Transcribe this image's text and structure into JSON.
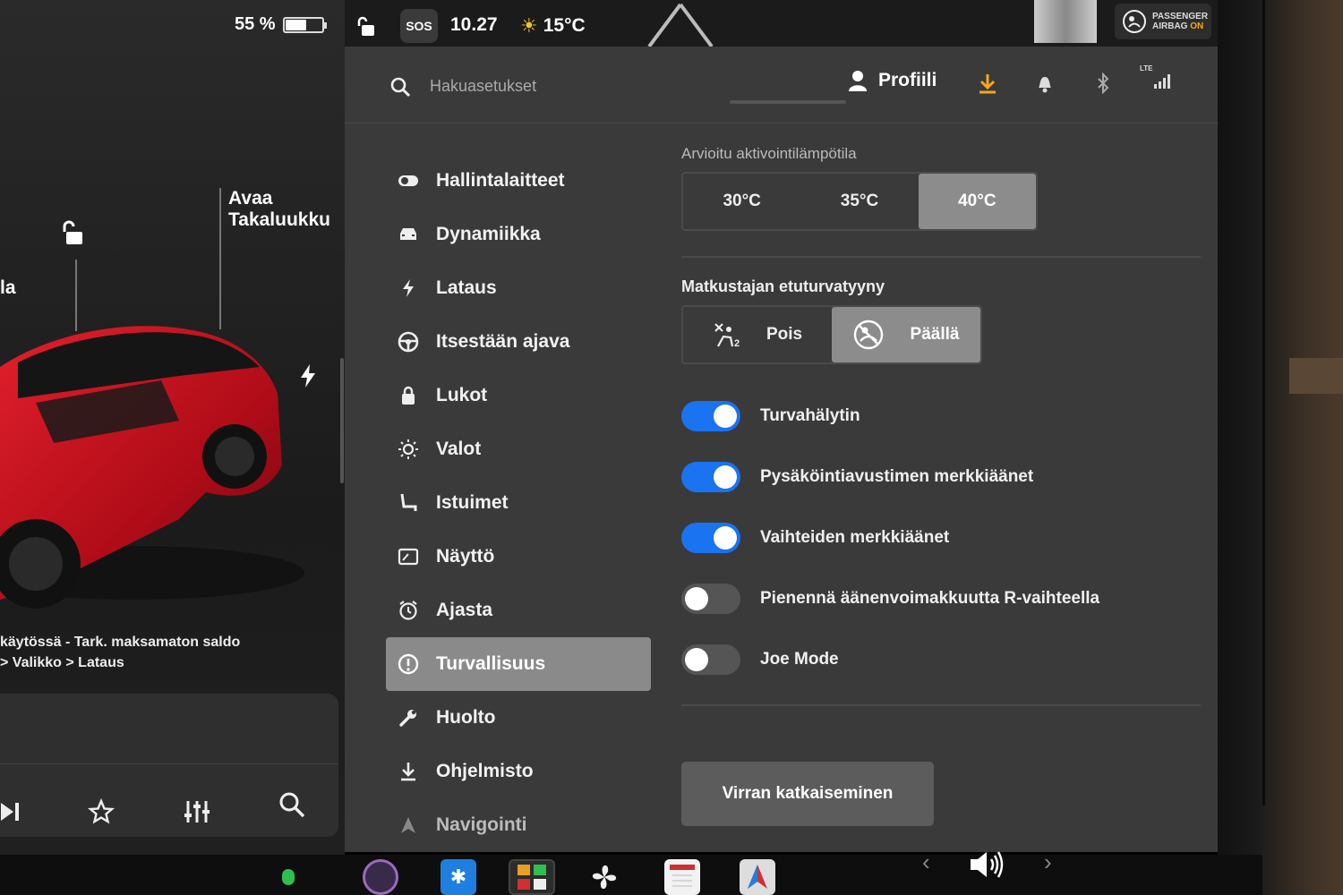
{
  "status": {
    "battery_percent": "55 %",
    "battery_level": 0.55,
    "sos_label": "SOS",
    "time": "10.27",
    "temperature": "15°C",
    "airbag_line1": "PASSENGER",
    "airbag_line2": "AIRBAG",
    "airbag_state": "ON"
  },
  "car": {
    "label_left": "la",
    "trunk_label_line1": "Avaa",
    "trunk_label_line2": "Takaluukku",
    "status_line1": "käytössä - Tark. maksamaton saldo",
    "status_line2": "> Valikko > Lataus"
  },
  "header": {
    "search_placeholder": "Hakuasetukset",
    "profile_label": "Profiili",
    "lte_label": "LTE"
  },
  "menu": [
    {
      "label": "Hallintalaitteet",
      "icon": "toggle-icon"
    },
    {
      "label": "Dynamiikka",
      "icon": "car-icon"
    },
    {
      "label": "Lataus",
      "icon": "bolt-icon"
    },
    {
      "label": "Itsestään ajava",
      "icon": "steering-wheel-icon"
    },
    {
      "label": "Lukot",
      "icon": "lock-icon"
    },
    {
      "label": "Valot",
      "icon": "light-icon"
    },
    {
      "label": "Istuimet",
      "icon": "seat-icon"
    },
    {
      "label": "Näyttö",
      "icon": "display-icon"
    },
    {
      "label": "Ajasta",
      "icon": "alarm-clock-icon"
    },
    {
      "label": "Turvallisuus",
      "icon": "alert-circle-icon",
      "active": true
    },
    {
      "label": "Huolto",
      "icon": "wrench-icon"
    },
    {
      "label": "Ohjelmisto",
      "icon": "download-icon"
    },
    {
      "label": "Navigointi",
      "icon": "navigation-icon"
    }
  ],
  "content": {
    "activation_temp_label": "Arvioitu aktivointilämpötila",
    "activation_temp_options": [
      "30°C",
      "35°C",
      "40°C"
    ],
    "activation_temp_selected": "40°C",
    "airbag_label": "Matkustajan etuturvatyyny",
    "airbag_off_label": "Pois",
    "airbag_on_label": "Päällä",
    "airbag_selected": "Päällä",
    "toggles": [
      {
        "label": "Turvahälytin",
        "on": true
      },
      {
        "label": "Pysäköintiavustimen merkkiäänet",
        "on": true
      },
      {
        "label": "Vaihteiden merkkiäänet",
        "on": true
      },
      {
        "label": "Pienennä äänenvoimakkuutta R-vaihteella",
        "on": false
      },
      {
        "label": "Joe Mode",
        "on": false
      }
    ],
    "power_off_label": "Virran katkaiseminen"
  },
  "colors": {
    "toggle_on": "#1a73f0",
    "download_accent": "#f3a81d",
    "car_red": "#c8101e"
  }
}
